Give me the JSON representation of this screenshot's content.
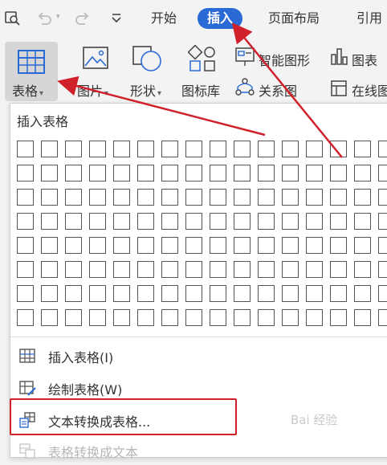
{
  "tabs": {
    "home": "开始",
    "insert": "插入",
    "layout": "页面布局",
    "reference": "引用"
  },
  "ribbon": {
    "table": "表格",
    "picture": "图片",
    "shape": "形状",
    "iconlib": "图标库",
    "smartart": "智能图形",
    "chart": "图表",
    "relation": "关系图",
    "online": "在线图"
  },
  "dropdown": {
    "title": "插入表格",
    "grid": {
      "rows": 8,
      "cols": 16
    },
    "items": [
      {
        "label": "插入表格(I)",
        "icon": "table-grid-icon",
        "disabled": false
      },
      {
        "label": "绘制表格(W)",
        "icon": "draw-table-icon",
        "disabled": false
      },
      {
        "label": "文本转换成表格...",
        "icon": "text-to-table-icon",
        "disabled": false
      },
      {
        "label": "表格转换成文本",
        "icon": "table-to-text-icon",
        "disabled": true
      }
    ]
  },
  "watermark": "Bai 经验",
  "colors": {
    "accent": "#2a6ad6",
    "annotation": "#d0202a"
  }
}
